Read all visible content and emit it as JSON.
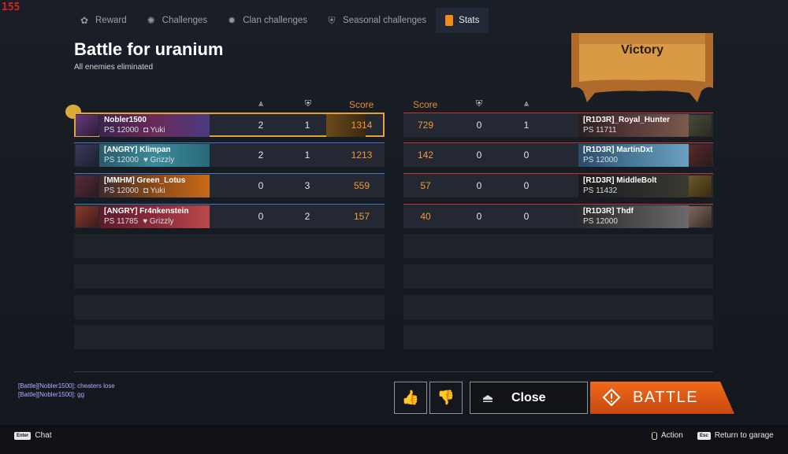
{
  "fps": "155",
  "tabs": [
    {
      "label": "Reward",
      "icon": "gift-icon"
    },
    {
      "label": "Challenges",
      "icon": "challenges-icon"
    },
    {
      "label": "Clan challenges",
      "icon": "clan-challenges-icon"
    },
    {
      "label": "Seasonal challenges",
      "icon": "seasonal-icon"
    },
    {
      "label": "Stats",
      "icon": "stats-icon",
      "active": true
    }
  ],
  "battle": {
    "title": "Battle for uranium",
    "subtitle": "All enemies eliminated",
    "result": "Victory"
  },
  "headers": {
    "score": "Score"
  },
  "allies": [
    {
      "name": "Nobler1500",
      "ps": "PS 12000",
      "clan": "Yuki",
      "kills": "2",
      "assists": "1",
      "score": "1314",
      "me": true
    },
    {
      "name": "[ANGRY] Klimpan",
      "ps": "PS 12000",
      "clan": "Grizzly",
      "kills": "2",
      "assists": "1",
      "score": "1213"
    },
    {
      "name": "[MMHM] Green_Lotus",
      "ps": "PS 12000",
      "clan": "Yuki",
      "kills": "0",
      "assists": "3",
      "score": "559"
    },
    {
      "name": "[ANGRY] Fr4nkenstein",
      "ps": "PS 11785",
      "clan": "Grizzly",
      "kills": "0",
      "assists": "2",
      "score": "157"
    }
  ],
  "enemies": [
    {
      "name": "[R1D3R]_Royal_Hunter",
      "ps": "PS 11711",
      "score": "729",
      "assists": "0",
      "kills": "1"
    },
    {
      "name": "[R1D3R] MartinDxt",
      "ps": "PS 12000",
      "score": "142",
      "assists": "0",
      "kills": "0"
    },
    {
      "name": "[R1D3R] MiddleBolt",
      "ps": "PS 11432",
      "score": "57",
      "assists": "0",
      "kills": "0"
    },
    {
      "name": "[R1D3R] Thdf",
      "ps": "PS 12000",
      "score": "40",
      "assists": "0",
      "kills": "0"
    }
  ],
  "chat": [
    "[Battle][Nobler1500]: cheaters lose",
    "[Battle][Nobler1500]: gg"
  ],
  "buttons": {
    "close": "Close",
    "battle": "BATTLE"
  },
  "footer": {
    "chat_key": "Enter",
    "chat_label": "Chat",
    "action_label": "Action",
    "return_key": "Esc",
    "return_label": "Return to garage"
  },
  "colors": {
    "accent": "#f28a1c",
    "ally": "#3a7ac9",
    "enemy": "#c8332e",
    "score": "#f09a3a"
  }
}
